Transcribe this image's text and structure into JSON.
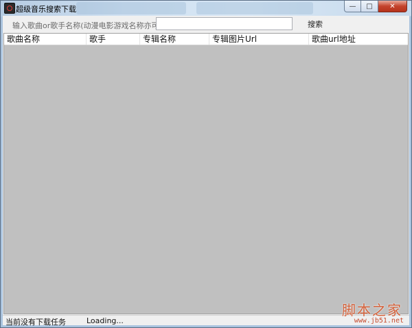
{
  "window": {
    "title": "超级音乐搜索下载"
  },
  "search": {
    "label": "输入歌曲or歌手名称(动漫电影游戏名称亦可)：",
    "value": "",
    "button_label": "搜索"
  },
  "table": {
    "columns": [
      "歌曲名称",
      "歌手",
      "专辑名称",
      "专辑图片Url",
      "歌曲url地址"
    ],
    "rows": []
  },
  "status": {
    "task_text": "当前没有下载任务",
    "loading_text": "Loading..."
  },
  "watermark": {
    "site_name": "脚本之家",
    "url": "www.jb51.net"
  }
}
